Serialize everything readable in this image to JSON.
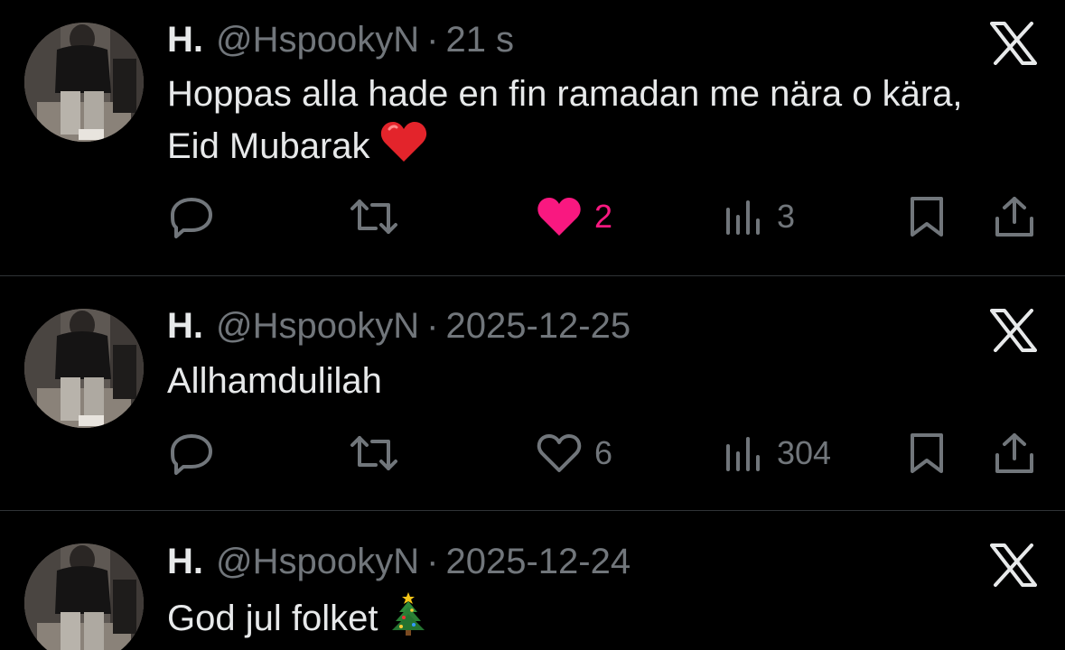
{
  "tweets": [
    {
      "name": "H.",
      "handle": "@HspookyN",
      "separator": "·",
      "time": "21 s",
      "text": "Hoppas alla hade en fin ramadan me nära o kära, Eid Mubarak",
      "emoji": "red-heart-emoji",
      "liked": true,
      "likes": "2",
      "views": "3",
      "like_color": "#f91880"
    },
    {
      "name": "H.",
      "handle": "@HspookyN",
      "separator": "·",
      "time": "2025-12-25",
      "text": "Allhamdulilah",
      "liked": false,
      "likes": "6",
      "views": "304"
    },
    {
      "name": "H.",
      "handle": "@HspookyN",
      "separator": "·",
      "time": "2025-12-24",
      "text": "God jul folket",
      "emoji": "christmas-tree-emoji"
    }
  ],
  "colors": {
    "background": "#000000",
    "text": "#e7e9ea",
    "muted": "#71767b",
    "divider": "#2f3336",
    "like": "#f91880"
  }
}
